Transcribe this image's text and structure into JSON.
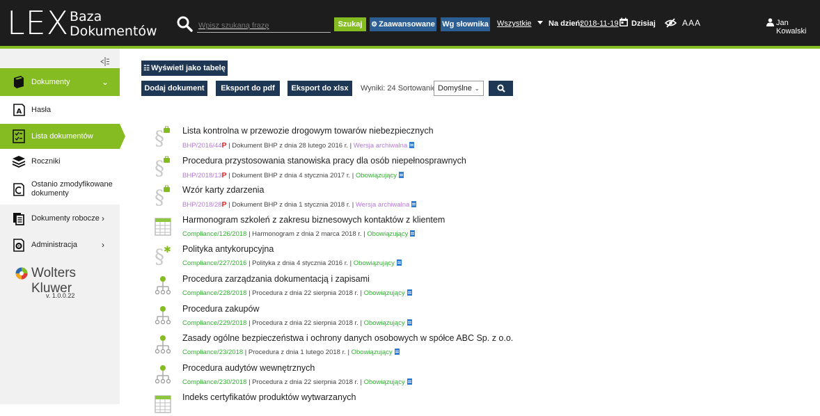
{
  "header": {
    "logo_main": "LEX",
    "logo_sub_1": "Baza",
    "logo_sub_2": "Dokumentów",
    "search_placeholder": "Wpisz szukaną frazę",
    "search_button": "Szukaj",
    "advanced_button": "Zaawansowane",
    "dictionary_button": "Wg słownika",
    "scope_select": "Wszystkie",
    "date_label": "Na dzień:",
    "date_value": "2018-11-19",
    "today_label": "Dzisiaj",
    "font_size_control": "AAA",
    "user_name": "Jan Kowalski"
  },
  "sidebar": {
    "items": [
      {
        "label": "Dokumenty",
        "icon": "book-icon"
      },
      {
        "label": "Hasła",
        "icon": "letter-a-icon"
      },
      {
        "label": "Lista dokumentów",
        "icon": "checklist-icon"
      },
      {
        "label": "Roczniki",
        "icon": "stack-icon"
      },
      {
        "label": "Ostanio zmodyfikowane dokumenty",
        "icon": "clock-document-icon"
      },
      {
        "label": "Dokumenty robocze",
        "icon": "copy-icon"
      },
      {
        "label": "Administracja",
        "icon": "settings-document-icon"
      }
    ],
    "brand": "Wolters Kluwer",
    "version": "v. 1.0.0.22"
  },
  "toolbar": {
    "table_view_button": "Wyświetl jako tabelę",
    "add_button": "Dodaj dokument",
    "export_pdf_button": "Eksport do pdf",
    "export_xlsx_button": "Eksport do xlsx",
    "results_label": "Wyniki: 24 Sortowanie:",
    "sort_value": "Domyślne"
  },
  "documents": [
    {
      "title": "Lista kontrolna w przewozie drogowym towarów niebezpiecznych",
      "signature": "BHP/2016/44",
      "desc": " | Dokument BHP z dnia 28 lutego 2016 r. | ",
      "status": "Wersja archiwalna",
      "icon": "paragraph-bag-icon"
    },
    {
      "title": "Procedura przystosowania stanowiska pracy dla osób niepełnosprawnych",
      "signature": "BHP/2018/13",
      "desc": " | Dokument BHP z dnia 4 stycznia 2017 r. | ",
      "status": "Obowiązujący",
      "icon": "paragraph-bag-icon"
    },
    {
      "title": "Wzór karty zdarzenia",
      "signature": "BHP/2018/28",
      "desc": " | Dokument BHP z dnia 1 stycznia 2018 r. | ",
      "status": "Wersja archiwalna",
      "icon": "paragraph-bag-icon"
    },
    {
      "title": "Harmonogram szkoleń z zakresu biznesowych kontaktów z klientem",
      "signature": "Compliance/126/2018",
      "desc": " | Harmonogram z dnia 2 marca 2018 r. | ",
      "status": "Obowiązujący",
      "icon": "table-icon"
    },
    {
      "title": "Polityka antykorupcyjna",
      "signature": "Compliance/227/2016",
      "desc": " | Polityka z dnia 4 stycznia 2016 r. | ",
      "status": "Obowiązujący",
      "icon": "paragraph-star-icon"
    },
    {
      "title": "Procedura zarządzania dokumentacją i zapisami",
      "signature": "Compliance/228/2018",
      "desc": " | Procedura z dnia 22 sierpnia 2018 r. | ",
      "status": "Obowiązujący",
      "icon": "hierarchy-icon"
    },
    {
      "title": "Procedura zakupów",
      "signature": "Compliance/229/2018",
      "desc": " | Procedura z dnia 22 sierpnia 2018 r. | ",
      "status": "Obowiązujący",
      "icon": "hierarchy-icon"
    },
    {
      "title": "Zasady ogólne bezpieczeństwa i ochrony danych osobowych w spółce ABC Sp. z o.o.",
      "signature": "Compliance/23/2018",
      "desc": " | Procedura z dnia 1 lutego 2018 r. | ",
      "status": "Obowiązujący",
      "icon": "hierarchy-icon"
    },
    {
      "title": "Procedura audytów wewnętrznych",
      "signature": "Compliance/230/2018",
      "desc": " | Procedura z dnia 22 sierpnia 2018 r. | ",
      "status": "Obowiązujący",
      "icon": "hierarchy-icon"
    },
    {
      "title": "Indeks certyfikatów produktów wytwarzanych",
      "signature": "",
      "desc": "",
      "status": "",
      "icon": "table-icon"
    }
  ],
  "pdf_marker": "P",
  "colors": {
    "accent": "#85bc22",
    "dark": "#1d1d1d",
    "button": "#1e3755",
    "blue": "#2b5e92",
    "archive": "#b57ad6",
    "active": "#32b032"
  }
}
